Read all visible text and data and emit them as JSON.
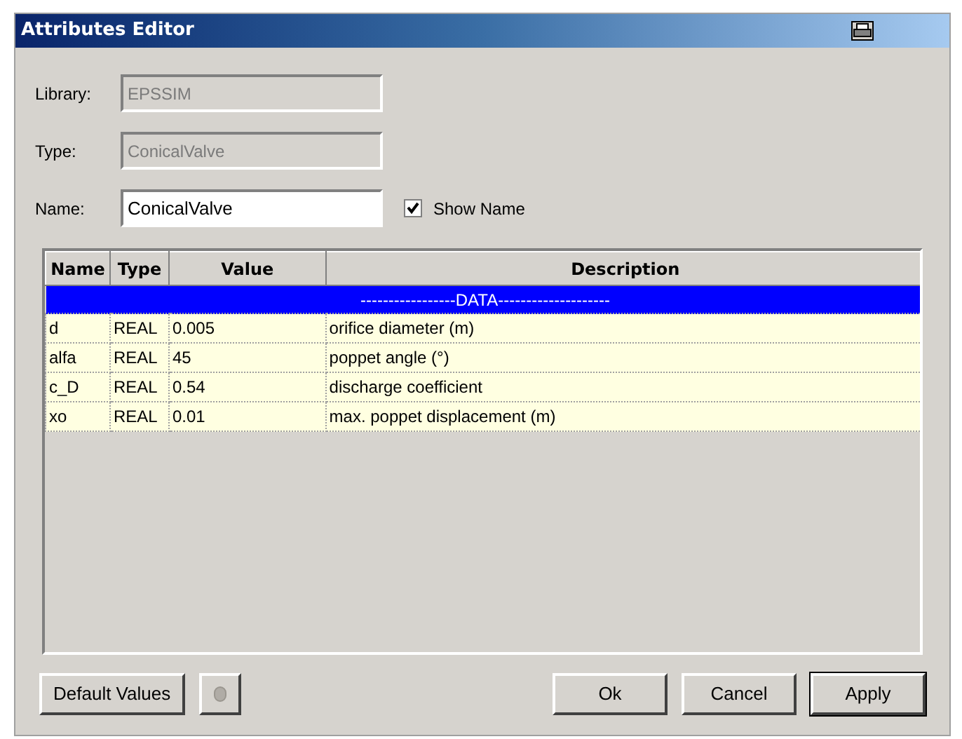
{
  "window": {
    "title": "Attributes Editor"
  },
  "fields": [
    {
      "label": "Library:",
      "value": "EPSSIM",
      "disabled": true
    },
    {
      "label": "Type:",
      "value": "ConicalValve",
      "disabled": true
    },
    {
      "label": "Name:",
      "value": "ConicalValve",
      "disabled": false
    }
  ],
  "show_name": {
    "label": "Show Name",
    "checked": true
  },
  "table": {
    "columns": [
      "Name",
      "Type",
      "Value",
      "Description"
    ],
    "rows": [
      {
        "kind": "group",
        "label": "-----------------DATA--------------------",
        "selected": true
      },
      {
        "kind": "param",
        "cells": [
          "d",
          "REAL",
          "0.005",
          "orifice diameter (m)"
        ],
        "selected": false
      },
      {
        "kind": "param",
        "cells": [
          "alfa",
          "REAL",
          "45",
          "poppet angle (°)"
        ],
        "selected": false
      },
      {
        "kind": "param",
        "cells": [
          "c_D",
          "REAL",
          "0.54",
          "discharge coefficient"
        ],
        "selected": false
      },
      {
        "kind": "param",
        "cells": [
          "xo",
          "REAL",
          "0.01",
          "max. poppet displacement (m)"
        ],
        "selected": false
      }
    ]
  },
  "buttons": [
    {
      "kind": "text",
      "label": "Default Values",
      "default": false
    },
    {
      "kind": "icon",
      "default": false
    },
    {
      "kind": "spacer"
    },
    {
      "kind": "text",
      "label": "Ok",
      "default": false
    },
    {
      "kind": "text",
      "label": "Cancel",
      "default": false
    },
    {
      "kind": "text",
      "label": "Apply",
      "default": true
    }
  ]
}
